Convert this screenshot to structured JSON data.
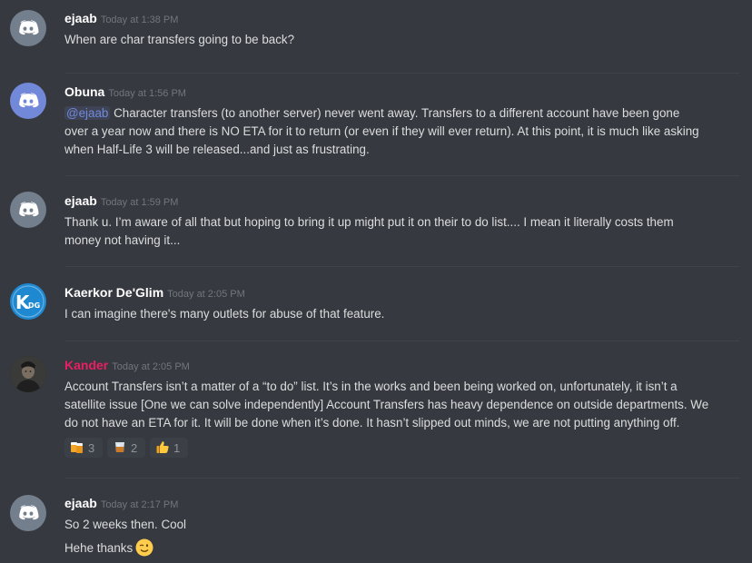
{
  "colors": {
    "background": "#36393f",
    "username_default": "#ffffff",
    "username_kander": "#e91e63",
    "mention": "#7289da",
    "discord_blurple": "#7289da",
    "discord_grey": "#747f8d"
  },
  "messages": [
    {
      "author": "ejaab",
      "timestamp": "Today at 1:38 PM",
      "avatar_icon": "discord-logo-grey-icon",
      "lines": [
        "When are char transfers going to be back?"
      ]
    },
    {
      "author": "Obuna",
      "timestamp": "Today at 1:56 PM",
      "avatar_icon": "discord-logo-blurple-icon",
      "mention": "@ejaab",
      "lines": [
        " Character transfers (to another server) never went away. Transfers to a different account have been gone",
        "over a year now and there is NO ETA for it to return (or even if they will ever return). At this point, it is much like asking",
        "when Half-Life 3 will be released...and just as frustrating."
      ]
    },
    {
      "author": "ejaab",
      "timestamp": "Today at 1:59 PM",
      "avatar_icon": "discord-logo-grey-icon",
      "lines": [
        "Thank u. I’m aware of all that but hoping to bring it up might put it on their to do list.... I mean it literally costs them",
        "money not having it..."
      ]
    },
    {
      "author": "Kaerkor De'Glim",
      "timestamp": "Today at 2:05 PM",
      "avatar_icon": "kdg-avatar-icon",
      "avatar_text_k": "K",
      "avatar_text_dg": "DG",
      "lines": [
        "I can imagine there's many outlets for abuse of that feature."
      ]
    },
    {
      "author": "Kander",
      "timestamp": "Today at 2:05 PM",
      "avatar_icon": "dark-portrait-avatar-icon",
      "lines": [
        "Account Transfers isn’t a matter of a “to do” list. It’s in the works and been being worked on, unfortunately, it isn’t a",
        "satellite issue [One we can solve independently] Account Transfers has heavy dependence on outside departments. We",
        "do not have an ETA for it. It will be done when it’s done. It hasn’t slipped out minds, we are not putting anything off."
      ],
      "reactions": [
        {
          "icon": "beer-mugs-icon",
          "count": "3"
        },
        {
          "icon": "tumbler-glass-icon",
          "count": "2"
        },
        {
          "icon": "thumbs-up-icon",
          "count": "1"
        }
      ]
    },
    {
      "author": "ejaab",
      "timestamp": "Today at 2:17 PM",
      "avatar_icon": "discord-logo-grey-icon",
      "lines": [
        "So 2 weeks then. Cool",
        "Hehe thanks"
      ],
      "trailing_emoji": "winking-face-icon"
    }
  ]
}
